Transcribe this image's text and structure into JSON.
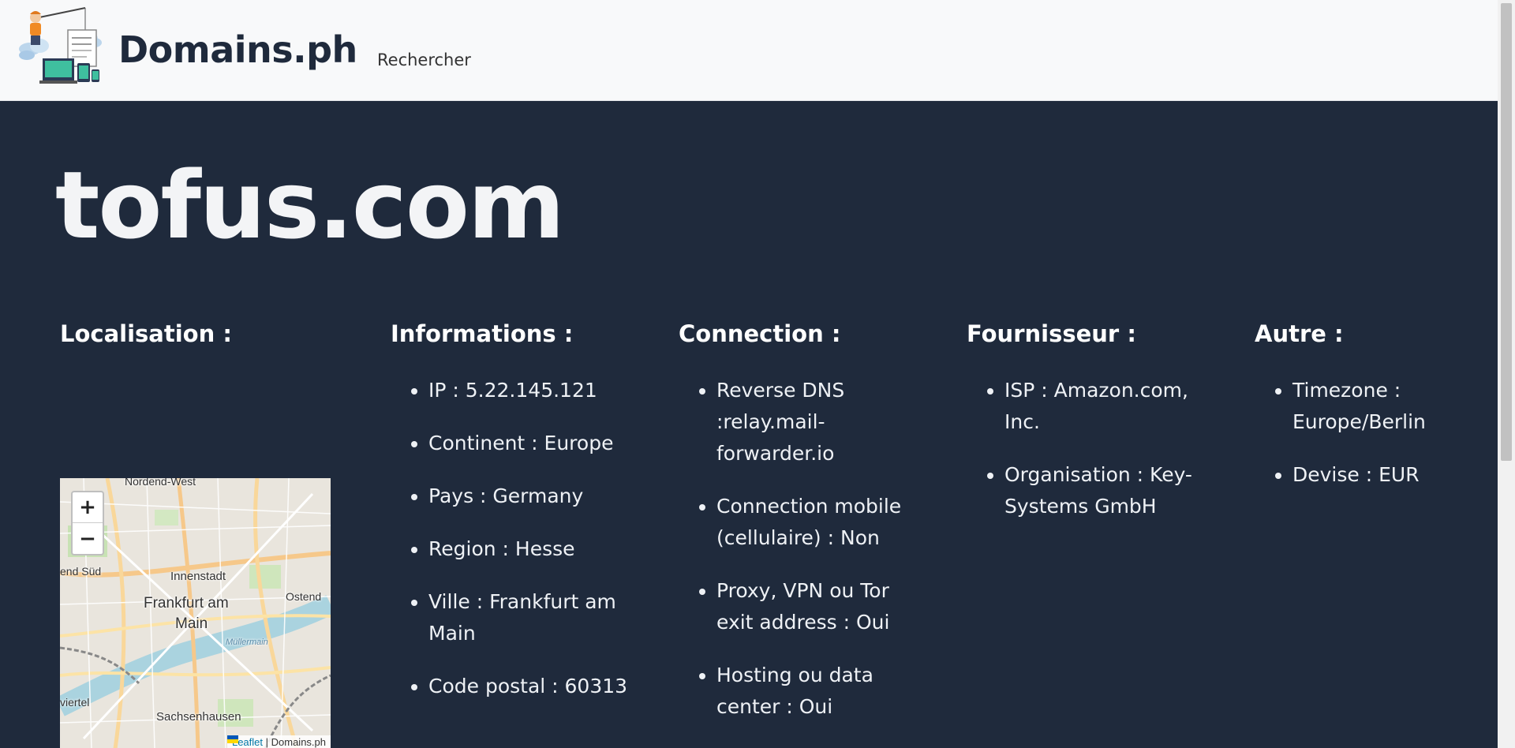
{
  "header": {
    "brand": "Domains.ph",
    "nav_search": "Rechercher"
  },
  "domain": "tofus.com",
  "localisation": {
    "heading": "Localisation :",
    "map": {
      "zoom_in": "+",
      "zoom_out": "−",
      "attribution_leaflet": "Leaflet",
      "attribution_sep": " | ",
      "attribution_source": "Domains.ph",
      "labels": [
        "Nordend-West",
        "Innenstadt",
        "Frankfurt am",
        "Main",
        "end Süd",
        "Ostend",
        "Sachsenhausen",
        "viertel",
        "Müllermain"
      ]
    }
  },
  "informations": {
    "heading": "Informations :",
    "items": [
      "IP : 5.22.145.121",
      "Continent : Europe",
      "Pays : Germany",
      "Region : Hesse",
      "Ville : Frankfurt am Main",
      "Code postal : 60313"
    ]
  },
  "connection": {
    "heading": "Connection :",
    "items": [
      "Reverse DNS :relay.mail-forwarder.io",
      "Connection mobile (cellulaire) : Non",
      "Proxy, VPN ou Tor exit address : Oui",
      "Hosting ou data center : Oui"
    ]
  },
  "fournisseur": {
    "heading": "Fournisseur :",
    "items": [
      "ISP : Amazon.com, Inc.",
      "Organisation : Key-Systems GmbH"
    ]
  },
  "autre": {
    "heading": "Autre :",
    "items": [
      "Timezone : Europe/Berlin",
      "Devise : EUR"
    ]
  },
  "colors": {
    "header_bg": "#f8f9fa",
    "main_bg": "#1f2a3c",
    "text_light": "#f1f3f5",
    "link_blue": "#0078a8"
  }
}
